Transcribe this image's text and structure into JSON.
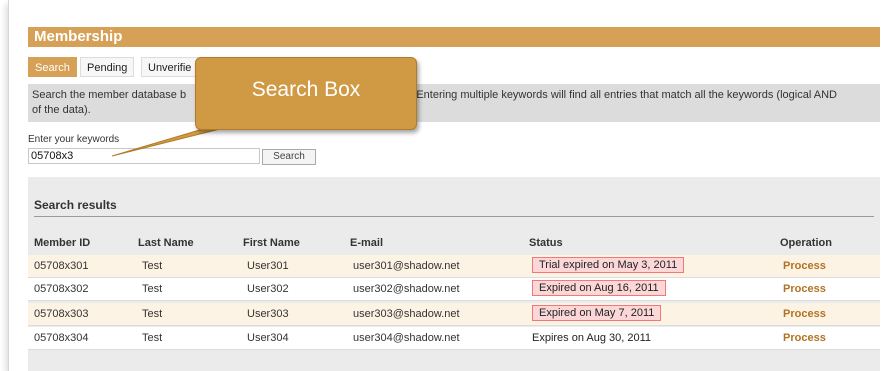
{
  "header": {
    "title": "Membership"
  },
  "tabs": [
    "Search",
    "Pending",
    "Unverifie"
  ],
  "description": {
    "text": "Search the member database b",
    "text_cont": ". Entering multiple keywords will find all entries that match all the keywords (logical AND",
    "text2": "of the data)."
  },
  "search": {
    "label": "Enter your keywords",
    "value": "05708x3",
    "button": "Search"
  },
  "results": {
    "title": "Search results",
    "columns": [
      "Member ID",
      "Last Name",
      "First Name",
      "E-mail",
      "Status",
      "Operation"
    ],
    "rows": [
      {
        "member_id": "05708x301",
        "last_name": "Test",
        "first_name": "User301",
        "email": "user301@shadow.net",
        "status": "Trial expired on May 3, 2011",
        "status_flag": "expired",
        "operation": "Process"
      },
      {
        "member_id": "05708x302",
        "last_name": "Test",
        "first_name": "User302",
        "email": "user302@shadow.net",
        "status": "Expired on Aug 16, 2011",
        "status_flag": "expired",
        "operation": "Process"
      },
      {
        "member_id": "05708x303",
        "last_name": "Test",
        "first_name": "User303",
        "email": "user303@shadow.net",
        "status": "Expired on May 7, 2011",
        "status_flag": "expired",
        "operation": "Process"
      },
      {
        "member_id": "05708x304",
        "last_name": "Test",
        "first_name": "User304",
        "email": "user304@shadow.net",
        "status": "Expires on Aug 30, 2011",
        "status_flag": "ok",
        "operation": "Process"
      }
    ]
  },
  "callout": {
    "text": "Search Box"
  },
  "colors": {
    "accent": "#d6a056",
    "callout": "#d09a44",
    "expired_fill": "#fbd7d7",
    "expired_border": "#f07878",
    "link": "#b07421"
  }
}
